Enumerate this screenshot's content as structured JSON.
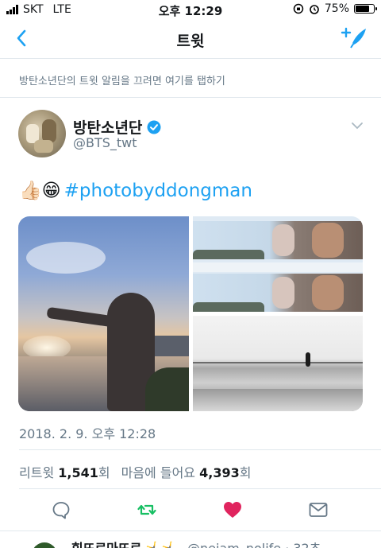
{
  "status_bar": {
    "carrier": "SKT",
    "network": "LTE",
    "time": "오후 12:29",
    "battery_text": "75%",
    "battery_level": 0.75
  },
  "nav": {
    "title": "트윗",
    "back_icon": "chevron-left-icon",
    "compose_icon": "compose-tweet-icon",
    "accent_color": "#1da1f2"
  },
  "notification_prompt": "방탄소년단의 트윗 알림을 끄려면 여기를 탭하기",
  "tweet": {
    "author_name": "방탄소년단",
    "author_handle": "@BTS_twt",
    "verified": true,
    "emoji": "👍🏻😁",
    "hashtag": "#photobyddongman",
    "timestamp": "2018. 2. 9. 오후 12:28",
    "retweet_label": "리트윗",
    "retweet_count": "1,541",
    "retweet_unit": "회",
    "like_label": "마음에 들어요",
    "like_count": "4,393",
    "like_unit": "회",
    "liked": true,
    "like_color": "#e0245e",
    "retweet_color": "#17bf63"
  },
  "next_tweet": {
    "name": "힘뜨르마뜨르 🤸‍♀️🤸",
    "handle": "@neiam_nolife · 32초"
  }
}
